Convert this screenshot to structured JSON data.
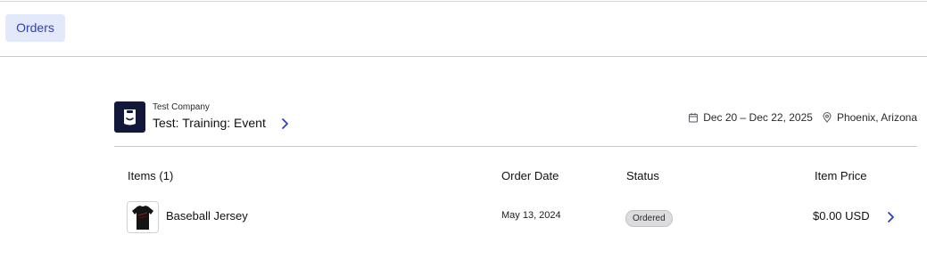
{
  "tabs": [
    {
      "label": "Orders",
      "active": true
    }
  ],
  "event": {
    "company": "Test Company",
    "name": "Test: Training: Event",
    "dates": "Dec 20 – Dec 22, 2025",
    "location": "Phoenix, Arizona"
  },
  "table": {
    "headers": {
      "items": "Items (1)",
      "order_date": "Order Date",
      "status": "Status",
      "item_price": "Item Price"
    },
    "rows": [
      {
        "product": "Baseball Jersey",
        "order_date": "May 13, 2024",
        "status": "Ordered",
        "price": "$0.00 USD"
      }
    ]
  },
  "colors": {
    "accent": "#2c3ec4",
    "tab_bg": "#e4e8fb",
    "logo_bg": "#13183a",
    "badge_bg": "#dcdcdf"
  },
  "icons": {
    "event_link": "chevron-right-icon",
    "dates": "calendar-icon",
    "location": "map-pin-icon",
    "row_link": "chevron-right-icon"
  }
}
